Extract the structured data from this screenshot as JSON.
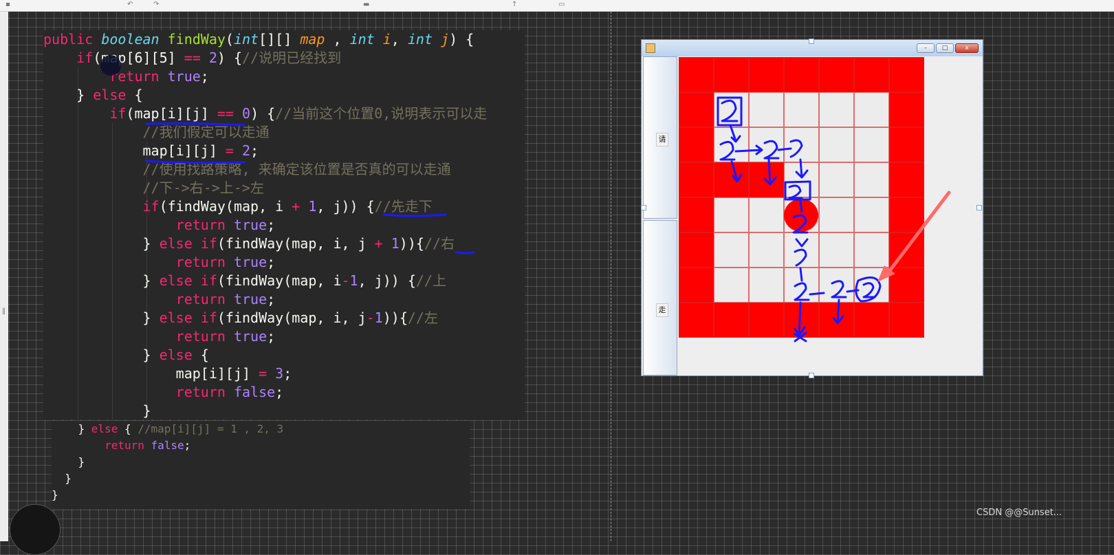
{
  "code_main": [
    [
      [
        "kw",
        "public "
      ],
      [
        "type",
        "boolean "
      ],
      [
        "fn",
        "findWay"
      ],
      [
        "plain",
        "("
      ],
      [
        "type",
        "int"
      ],
      [
        "plain",
        "[][] "
      ],
      [
        "param",
        "map"
      ],
      [
        "plain",
        " , "
      ],
      [
        "type",
        "int "
      ],
      [
        "param",
        "i"
      ],
      [
        "plain",
        ", "
      ],
      [
        "type",
        "int "
      ],
      [
        "param",
        "j"
      ],
      [
        "plain",
        ") {"
      ]
    ],
    [
      [
        "plain",
        "    "
      ],
      [
        "kw",
        "if"
      ],
      [
        "plain",
        "(map[6][5] "
      ],
      [
        "kw",
        "=="
      ],
      [
        "plain",
        " "
      ],
      [
        "num",
        "2"
      ],
      [
        "plain",
        ") {"
      ],
      [
        "cm",
        "//说明已经找到"
      ]
    ],
    [
      [
        "plain",
        "        "
      ],
      [
        "kw",
        "return "
      ],
      [
        "num",
        "true"
      ],
      [
        "plain",
        ";"
      ]
    ],
    [
      [
        "plain",
        "    } "
      ],
      [
        "kw",
        "else"
      ],
      [
        "plain",
        " {"
      ]
    ],
    [
      [
        "plain",
        "        "
      ],
      [
        "kw",
        "if"
      ],
      [
        "plain",
        "(map[i][j] "
      ],
      [
        "kw",
        "=="
      ],
      [
        "plain",
        " "
      ],
      [
        "num",
        "0"
      ],
      [
        "plain",
        ") {"
      ],
      [
        "cm",
        "//当前这个位置0,说明表示可以走"
      ]
    ],
    [
      [
        "plain",
        "            "
      ],
      [
        "cm",
        "//我们假定可以走通"
      ]
    ],
    [
      [
        "plain",
        "            map[i][j] "
      ],
      [
        "kw",
        "="
      ],
      [
        "plain",
        " "
      ],
      [
        "num",
        "2"
      ],
      [
        "plain",
        ";"
      ]
    ],
    [
      [
        "plain",
        "            "
      ],
      [
        "cm",
        "//使用找路策略, 来确定该位置是否真的可以走通"
      ]
    ],
    [
      [
        "plain",
        "            "
      ],
      [
        "cm",
        "//下->右->上->左"
      ]
    ],
    [
      [
        "plain",
        "            "
      ],
      [
        "kw",
        "if"
      ],
      [
        "plain",
        "(findWay(map, i "
      ],
      [
        "kw",
        "+"
      ],
      [
        "plain",
        " "
      ],
      [
        "num",
        "1"
      ],
      [
        "plain",
        ", j)) {"
      ],
      [
        "cm",
        "//先走下"
      ]
    ],
    [
      [
        "plain",
        "                "
      ],
      [
        "kw",
        "return "
      ],
      [
        "num",
        "true"
      ],
      [
        "plain",
        ";"
      ]
    ],
    [
      [
        "plain",
        "            } "
      ],
      [
        "kw",
        "else if"
      ],
      [
        "plain",
        "(findWay(map, i, j "
      ],
      [
        "kw",
        "+"
      ],
      [
        "plain",
        " "
      ],
      [
        "num",
        "1"
      ],
      [
        "plain",
        "))"
      ],
      [
        "plain",
        "{"
      ],
      [
        "cm",
        "//右"
      ]
    ],
    [
      [
        "plain",
        "                "
      ],
      [
        "kw",
        "return "
      ],
      [
        "num",
        "true"
      ],
      [
        "plain",
        ";"
      ]
    ],
    [
      [
        "plain",
        "            } "
      ],
      [
        "kw",
        "else if"
      ],
      [
        "plain",
        "(findWay(map, i"
      ],
      [
        "kw",
        "-"
      ],
      [
        "num",
        "1"
      ],
      [
        "plain",
        ", j)) {"
      ],
      [
        "cm",
        "//上"
      ]
    ],
    [
      [
        "plain",
        "                "
      ],
      [
        "kw",
        "return "
      ],
      [
        "num",
        "true"
      ],
      [
        "plain",
        ";"
      ]
    ],
    [
      [
        "plain",
        "            } "
      ],
      [
        "kw",
        "else if"
      ],
      [
        "plain",
        "(findWay(map, i, j"
      ],
      [
        "kw",
        "-"
      ],
      [
        "num",
        "1"
      ],
      [
        "plain",
        "))"
      ],
      [
        "plain",
        "{"
      ],
      [
        "cm",
        "//左"
      ]
    ],
    [
      [
        "plain",
        "                "
      ],
      [
        "kw",
        "return "
      ],
      [
        "num",
        "true"
      ],
      [
        "plain",
        ";"
      ]
    ],
    [
      [
        "plain",
        "            } "
      ],
      [
        "kw",
        "else"
      ],
      [
        "plain",
        " {"
      ]
    ],
    [
      [
        "plain",
        "                map[i][j] "
      ],
      [
        "kw",
        "="
      ],
      [
        "plain",
        " "
      ],
      [
        "num",
        "3"
      ],
      [
        "plain",
        ";"
      ]
    ],
    [
      [
        "plain",
        "                "
      ],
      [
        "kw",
        "return "
      ],
      [
        "num",
        "false"
      ],
      [
        "plain",
        ";"
      ]
    ],
    [
      [
        "plain",
        "            }"
      ]
    ]
  ],
  "code_secondary": [
    [
      [
        "plain",
        "    } "
      ],
      [
        "kw",
        "else"
      ],
      [
        "plain",
        " { "
      ],
      [
        "cm",
        "//map[i][j] = 1 , 2, 3"
      ]
    ],
    [
      [
        "plain",
        "        "
      ],
      [
        "kw",
        "return "
      ],
      [
        "num",
        "false"
      ],
      [
        "plain",
        ";"
      ]
    ],
    [
      [
        "plain",
        "    }"
      ]
    ],
    [
      [
        "plain",
        "  }"
      ]
    ],
    [
      [
        "plain",
        "}"
      ]
    ]
  ],
  "maze": {
    "title_icon": "java-cup-icon",
    "buttons": {
      "minimize": "-",
      "maximize": "□",
      "close": "x"
    },
    "side_labels": [
      "请",
      "走"
    ],
    "grid": [
      [
        1,
        1,
        1,
        1,
        1,
        1,
        1
      ],
      [
        1,
        0,
        0,
        0,
        0,
        0,
        1
      ],
      [
        1,
        0,
        0,
        0,
        0,
        0,
        1
      ],
      [
        1,
        1,
        1,
        0,
        0,
        0,
        1
      ],
      [
        1,
        0,
        0,
        0,
        0,
        0,
        1
      ],
      [
        1,
        0,
        0,
        0,
        0,
        0,
        1
      ],
      [
        1,
        0,
        0,
        0,
        0,
        0,
        1
      ],
      [
        1,
        1,
        1,
        1,
        1,
        1,
        1
      ]
    ]
  },
  "watermark": "CSDN @@Sunset...",
  "colors": {
    "wall": "#ff0000",
    "open": "#ececec",
    "ink": "#1a1aff"
  }
}
